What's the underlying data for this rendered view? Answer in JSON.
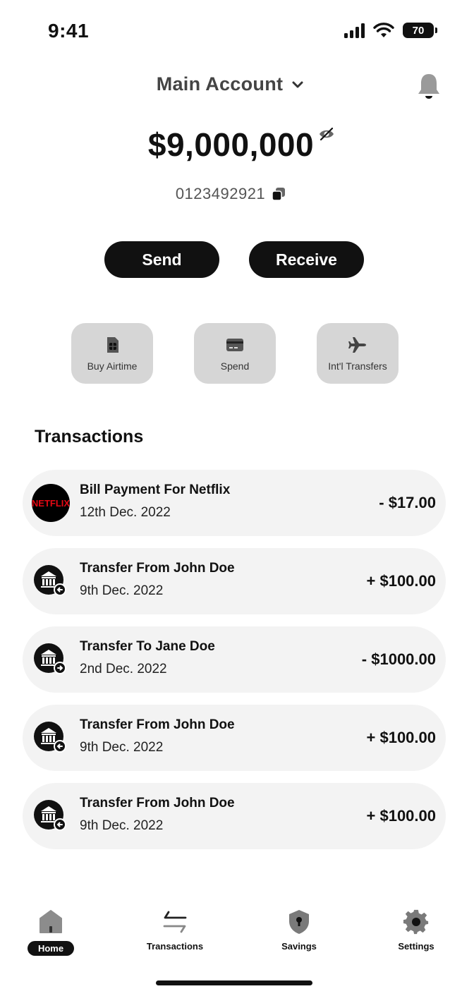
{
  "status_bar": {
    "time": "9:41",
    "battery": "70"
  },
  "header": {
    "account_name": "Main Account"
  },
  "balance": {
    "amount": "$9,000,000",
    "account_number": "0123492921"
  },
  "actions": {
    "send": "Send",
    "receive": "Receive"
  },
  "quick_actions": [
    {
      "label": "Buy Airtime",
      "icon": "sim-card-icon"
    },
    {
      "label": "Spend",
      "icon": "card-icon"
    },
    {
      "label": "Int'l Transfers",
      "icon": "airplane-icon"
    }
  ],
  "transactions": {
    "heading": "Transactions",
    "items": [
      {
        "title": "Bill Payment For Netflix",
        "date": "12th Dec. 2022",
        "amount": "- $17.00",
        "icon": "netflix-logo",
        "logo_text": "NETFLIX"
      },
      {
        "title": "Transfer From John Doe",
        "date": "9th Dec. 2022",
        "amount": "+ $100.00",
        "icon": "bank-incoming-icon"
      },
      {
        "title": "Transfer To Jane Doe",
        "date": "2nd Dec. 2022",
        "amount": "- $1000.00",
        "icon": "bank-outgoing-icon"
      },
      {
        "title": "Transfer From John Doe",
        "date": "9th Dec. 2022",
        "amount": "+ $100.00",
        "icon": "bank-incoming-icon"
      },
      {
        "title": "Transfer From John Doe",
        "date": "9th Dec. 2022",
        "amount": "+ $100.00",
        "icon": "bank-incoming-icon"
      }
    ]
  },
  "bottom_nav": [
    {
      "label": "Home",
      "icon": "home-icon",
      "active": true
    },
    {
      "label": "Transactions",
      "icon": "transfer-arrows-icon",
      "active": false
    },
    {
      "label": "Savings",
      "icon": "shield-lock-icon",
      "active": false
    },
    {
      "label": "Settings",
      "icon": "gear-icon",
      "active": false
    }
  ],
  "colors": {
    "primary": "#111111",
    "card_bg": "#f3f3f3",
    "quick_bg": "#d6d6d6",
    "netflix_red": "#e50914"
  }
}
